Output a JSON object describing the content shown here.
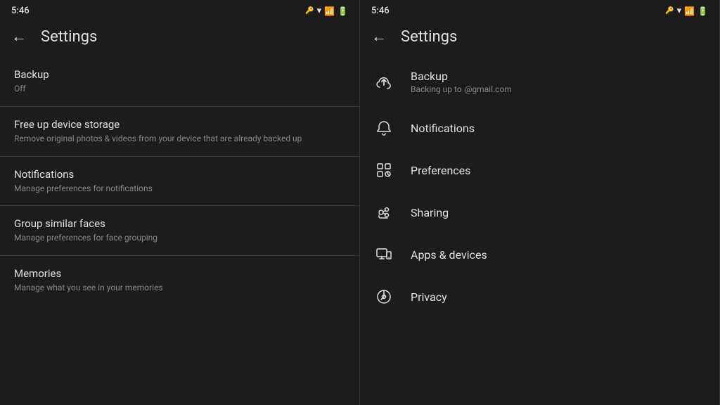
{
  "left_panel": {
    "status_time": "5:46",
    "header_title": "Settings",
    "back_arrow": "←",
    "items": [
      {
        "title": "Backup",
        "subtitle": "Off",
        "has_divider": true
      },
      {
        "title": "Free up device storage",
        "subtitle": "Remove original photos & videos from your device that are already backed up",
        "has_divider": true
      },
      {
        "title": "Notifications",
        "subtitle": "Manage preferences for notifications",
        "has_divider": true
      },
      {
        "title": "Group similar faces",
        "subtitle": "Manage preferences for face grouping",
        "has_divider": true
      },
      {
        "title": "Memories",
        "subtitle": "Manage what you see in your memories",
        "has_divider": false
      }
    ]
  },
  "right_panel": {
    "status_time": "5:46",
    "header_title": "Settings",
    "back_arrow": "←",
    "items": [
      {
        "icon": "backup",
        "title": "Backup",
        "has_subtitle": true,
        "subtitle_label": "Backing up to",
        "subtitle_value": "@gmail.com"
      },
      {
        "icon": "notifications",
        "title": "Notifications",
        "has_subtitle": false
      },
      {
        "icon": "preferences",
        "title": "Preferences",
        "has_subtitle": false
      },
      {
        "icon": "sharing",
        "title": "Sharing",
        "has_subtitle": false
      },
      {
        "icon": "apps-devices",
        "title": "Apps & devices",
        "has_subtitle": false
      },
      {
        "icon": "privacy",
        "title": "Privacy",
        "has_subtitle": false
      }
    ]
  }
}
